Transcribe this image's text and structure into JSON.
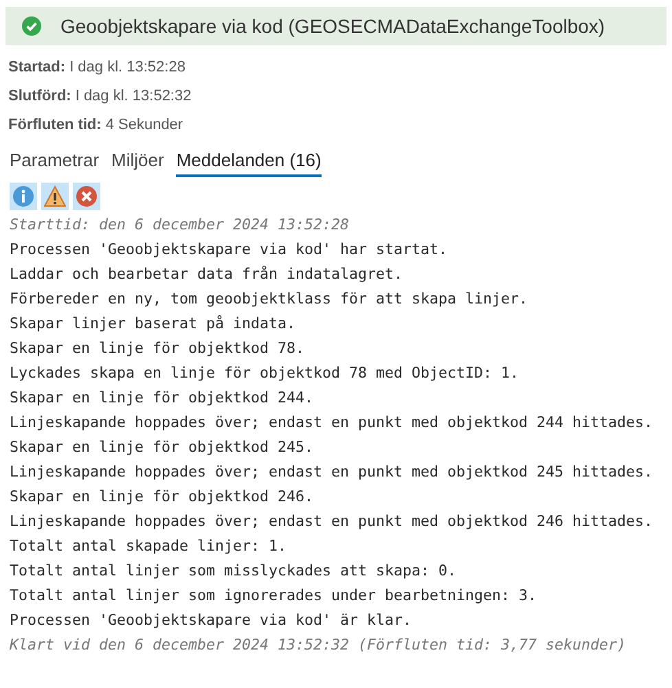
{
  "header": {
    "kind": "success",
    "title": "Geoobjektskapare via kod (GEOSECMADataExchangeToolbox)"
  },
  "details": [
    {
      "label": "Startad:",
      "value": "I dag kl. 13:52:28"
    },
    {
      "label": "Slutförd:",
      "value": "I dag kl. 13:52:32"
    },
    {
      "label": "Förfluten tid:",
      "value": "4 Sekunder"
    }
  ],
  "tabs": [
    {
      "label": "Parametrar",
      "selected": false
    },
    {
      "label": "Miljöer",
      "selected": false
    },
    {
      "label": "Meddelanden (16)",
      "selected": true
    }
  ],
  "filters": [
    {
      "kind": "info",
      "selected": true
    },
    {
      "kind": "warning",
      "selected": true
    },
    {
      "kind": "error",
      "selected": true
    }
  ],
  "messages": [
    {
      "kind": "time",
      "text": "Starttid: den 6 december 2024 13:52:28"
    },
    {
      "kind": "message",
      "text": "Processen 'Geoobjektskapare via kod' har startat."
    },
    {
      "kind": "message",
      "text": "Laddar och bearbetar data från indatalagret."
    },
    {
      "kind": "message",
      "text": "Förbereder en ny, tom geoobjektklass för att skapa linjer."
    },
    {
      "kind": "message",
      "text": "Skapar linjer baserat på indata."
    },
    {
      "kind": "message",
      "text": "Skapar en linje för objektkod 78."
    },
    {
      "kind": "message",
      "text": "Lyckades skapa en linje för objektkod 78 med ObjectID: 1."
    },
    {
      "kind": "message",
      "text": "Skapar en linje för objektkod 244."
    },
    {
      "kind": "message",
      "text": "Linjeskapande hoppades över; endast en punkt med objektkod 244 hittades."
    },
    {
      "kind": "message",
      "text": "Skapar en linje för objektkod 245."
    },
    {
      "kind": "message",
      "text": "Linjeskapande hoppades över; endast en punkt med objektkod 245 hittades."
    },
    {
      "kind": "message",
      "text": "Skapar en linje för objektkod 246."
    },
    {
      "kind": "message",
      "text": "Linjeskapande hoppades över; endast en punkt med objektkod 246 hittades."
    },
    {
      "kind": "message",
      "text": "Totalt antal skapade linjer: 1."
    },
    {
      "kind": "message",
      "text": "Totalt antal linjer som misslyckades att skapa: 0."
    },
    {
      "kind": "message",
      "text": "Totalt antal linjer som ignorerades under bearbetningen: 3."
    },
    {
      "kind": "message",
      "text": "Processen 'Geoobjektskapare via kod' är klar."
    },
    {
      "kind": "time",
      "text": "Klart vid den 6 december 2024 13:52:32 (Förfluten tid: 3,77 sekunder)"
    }
  ]
}
